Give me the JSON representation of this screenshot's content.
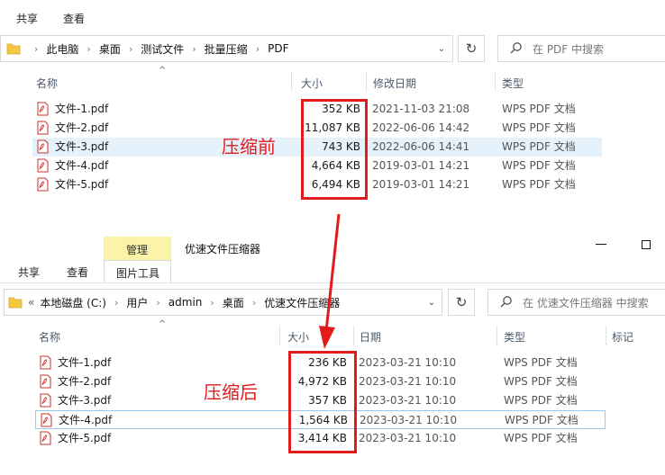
{
  "win1": {
    "ribbon": {
      "tab_share": "共享",
      "tab_view": "查看"
    },
    "breadcrumb": [
      "此电脑",
      "桌面",
      "测试文件",
      "批量压缩",
      "PDF"
    ],
    "search_placeholder": "在 PDF 中搜索",
    "columns": {
      "name": "名称",
      "size": "大小",
      "modified": "修改日期",
      "type": "类型"
    },
    "files": [
      {
        "name": "文件-1.pdf",
        "size": "352 KB",
        "date": "2021-11-03 21:08",
        "type": "WPS PDF 文档"
      },
      {
        "name": "文件-2.pdf",
        "size": "11,087 KB",
        "date": "2022-06-06 14:42",
        "type": "WPS PDF 文档"
      },
      {
        "name": "文件-3.pdf",
        "size": "743 KB",
        "date": "2022-06-06 14:41",
        "type": "WPS PDF 文档"
      },
      {
        "name": "文件-4.pdf",
        "size": "4,664 KB",
        "date": "2019-03-01 14:21",
        "type": "WPS PDF 文档"
      },
      {
        "name": "文件-5.pdf",
        "size": "6,494 KB",
        "date": "2019-03-01 14:21",
        "type": "WPS PDF 文档"
      }
    ],
    "annotation": "压缩前"
  },
  "win2": {
    "ribbon": {
      "manage": "管理",
      "title": "优速文件压缩器",
      "tab_share": "共享",
      "tab_view": "查看",
      "tab_picture_tools": "图片工具"
    },
    "breadcrumb_prefix": "«",
    "breadcrumb": [
      "本地磁盘 (C:)",
      "用户",
      "admin",
      "桌面",
      "优速文件压缩器"
    ],
    "search_placeholder": "在 优速文件压缩器 中搜索",
    "columns": {
      "name": "名称",
      "size": "大小",
      "date": "日期",
      "type": "类型",
      "tags": "标记"
    },
    "files": [
      {
        "name": "文件-1.pdf",
        "size": "236 KB",
        "date": "2023-03-21 10:10",
        "type": "WPS PDF 文档"
      },
      {
        "name": "文件-2.pdf",
        "size": "4,972 KB",
        "date": "2023-03-21 10:10",
        "type": "WPS PDF 文档"
      },
      {
        "name": "文件-3.pdf",
        "size": "357 KB",
        "date": "2023-03-21 10:10",
        "type": "WPS PDF 文档"
      },
      {
        "name": "文件-4.pdf",
        "size": "1,564 KB",
        "date": "2023-03-21 10:10",
        "type": "WPS PDF 文档"
      },
      {
        "name": "文件-5.pdf",
        "size": "3,414 KB",
        "date": "2023-03-21 10:10",
        "type": "WPS PDF 文档"
      }
    ],
    "annotation": "压缩后"
  },
  "colors": {
    "annotation_red": "#e21c1c",
    "selection": "#e5f1fb",
    "manage_tab": "#fbf4a8"
  },
  "icons": [
    "folder-icon",
    "chevron-right-icon",
    "chevron-down-icon",
    "refresh-icon",
    "search-icon",
    "pdf-file-icon",
    "minimize-icon",
    "maximize-icon",
    "up-caret-icon"
  ]
}
